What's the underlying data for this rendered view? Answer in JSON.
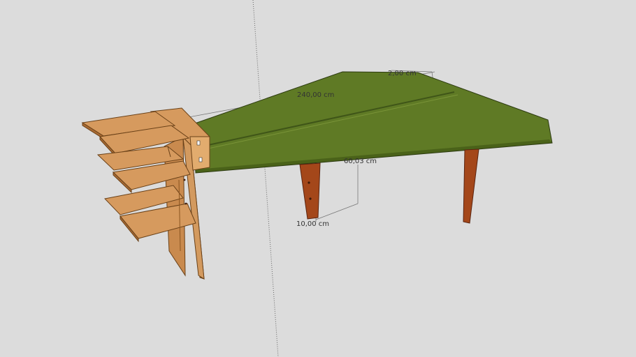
{
  "scene": {
    "background": "#dcdcdc",
    "colors": {
      "tabletop": "#5f7a25",
      "tabletop_edge": "#3f5518",
      "wood": "#cf8f52",
      "wood_dark": "#a86a33",
      "legs": "#a4471a",
      "guide_line": "#555555"
    }
  },
  "dimensions": {
    "top_width": "2,00 cm",
    "top_length": "240,00 cm",
    "leg_height": "60,03 cm",
    "leg_width": "10,00 cm"
  }
}
